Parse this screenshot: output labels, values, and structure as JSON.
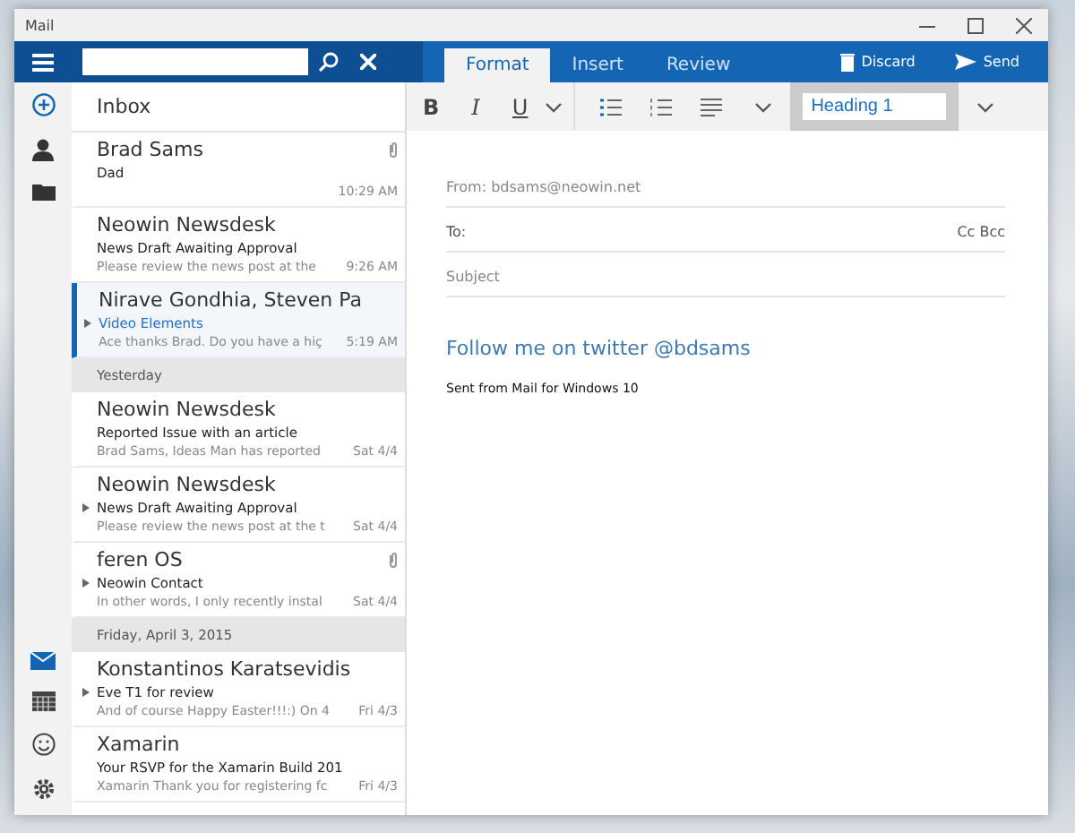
{
  "window": {
    "title": "Mail"
  },
  "folder": {
    "title": "Inbox"
  },
  "messages": [
    {
      "kind": "message",
      "sender": "Brad Sams",
      "subject": "Dad",
      "time": "10:29 AM",
      "attachment": true,
      "thread": false,
      "selected": false
    },
    {
      "kind": "message",
      "sender": "Neowin Newsdesk",
      "subject": "News Draft Awaiting Approval",
      "preview": "Please review the news post at the",
      "time": "9:26 AM",
      "attachment": false,
      "thread": false,
      "selected": false
    },
    {
      "kind": "message",
      "sender": "Nirave Gondhia, Steven Pa",
      "subject": "Video Elements",
      "preview": "Ace thanks Brad. Do you have a hiç",
      "time": "5:19 AM",
      "attachment": false,
      "thread": true,
      "selected": true
    },
    {
      "kind": "header",
      "label": "Yesterday"
    },
    {
      "kind": "message",
      "sender": "Neowin Newsdesk",
      "subject": "Reported Issue with an article",
      "preview": "Brad Sams, Ideas Man has reported",
      "time": "Sat 4/4",
      "attachment": false,
      "thread": false,
      "selected": false
    },
    {
      "kind": "message",
      "sender": "Neowin Newsdesk",
      "subject": "News Draft Awaiting Approval",
      "preview": "Please review the news post at the t",
      "time": "Sat 4/4",
      "attachment": false,
      "thread": true,
      "selected": false
    },
    {
      "kind": "message",
      "sender": "feren OS",
      "subject": "Neowin Contact",
      "preview": "In other words, I only recently instal",
      "time": "Sat 4/4",
      "attachment": true,
      "thread": true,
      "selected": false
    },
    {
      "kind": "header",
      "label": "Friday, April 3, 2015"
    },
    {
      "kind": "message",
      "sender": "Konstantinos Karatsevidis",
      "subject": "Eve T1 for review",
      "preview": "And of course Happy Easter!!!:) On 4",
      "time": "Fri 4/3",
      "attachment": false,
      "thread": true,
      "selected": false
    },
    {
      "kind": "message",
      "sender": "Xamarin",
      "subject": "Your RSVP for the Xamarin Build 201",
      "preview": "Xamarin Thank you for registering fc",
      "time": "Fri 4/3",
      "attachment": false,
      "thread": false,
      "selected": false
    }
  ],
  "tabs": [
    {
      "label": "Format",
      "selected": true
    },
    {
      "label": "Insert",
      "selected": false
    },
    {
      "label": "Review",
      "selected": false
    }
  ],
  "actions": [
    {
      "kind": "discard",
      "label": "Discard"
    },
    {
      "kind": "send",
      "label": "Send"
    }
  ],
  "format_toolbar": {
    "bold": "B",
    "italic": "I",
    "underline": "U",
    "style": "Heading 1"
  },
  "compose": {
    "from_label": "From:",
    "from": "bdsams@neowin.net",
    "to_label": "To:",
    "cc_bcc": "Cc Bcc",
    "subject_placeholder": "Subject",
    "body": "Follow me on twitter @bdsams",
    "signature": "Sent from Mail for Windows 10"
  }
}
